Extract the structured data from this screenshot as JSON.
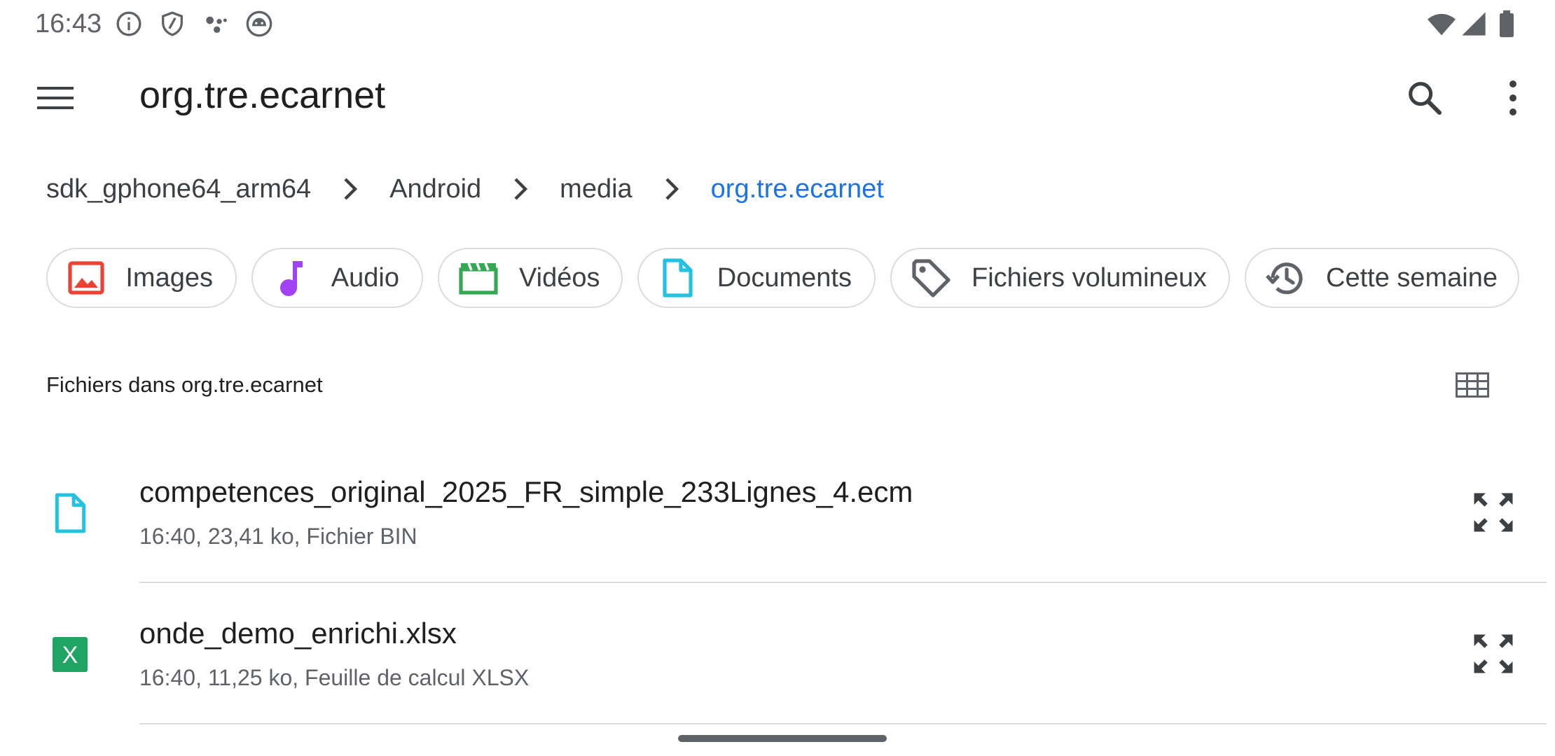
{
  "status_bar": {
    "time": "16:43",
    "icons": [
      "info-icon",
      "shield-icon",
      "assistant-dots-icon",
      "android-face-icon",
      "wifi-icon",
      "signal-icon",
      "battery-icon"
    ]
  },
  "app_bar": {
    "title": "org.tre.ecarnet",
    "menu_icon": "hamburger-menu-icon",
    "search_icon": "search-icon",
    "more_icon": "more-vert-icon"
  },
  "breadcrumb": {
    "items": [
      "sdk_gphone64_arm64",
      "Android",
      "media",
      "org.tre.ecarnet"
    ],
    "separator_icon": "chevron-right-icon"
  },
  "chips": [
    {
      "label": "Images",
      "icon": "image-icon",
      "color": "#ea4335"
    },
    {
      "label": "Audio",
      "icon": "music-note-icon",
      "color": "#a142f4"
    },
    {
      "label": "Vidéos",
      "icon": "movie-clapper-icon",
      "color": "#34a853"
    },
    {
      "label": "Documents",
      "icon": "document-icon",
      "color": "#24c1e0"
    },
    {
      "label": "Fichiers volumineux",
      "icon": "tag-icon",
      "color": "#5f6368"
    },
    {
      "label": "Cette semaine",
      "icon": "history-icon",
      "color": "#5f6368"
    }
  ],
  "section": {
    "title": "Fichiers dans org.tre.ecarnet",
    "view_toggle_icon": "grid-view-icon"
  },
  "files": [
    {
      "name": "competences_original_2025_FR_simple_233Lignes_4.ecm",
      "meta": "16:40, 23,41 ko, Fichier BIN",
      "icon": "document-icon",
      "color": "#24c1e0"
    },
    {
      "name": "onde_demo_enrichi.xlsx",
      "meta": "16:40, 11,25 ko, Feuille de calcul XLSX",
      "icon": "spreadsheet-icon",
      "color": "#1fa463",
      "icon_letter": "X"
    }
  ],
  "colors": {
    "accent": "#1a73e8",
    "text_primary": "#1f1f1f",
    "text_secondary": "#5f6368",
    "divider": "#dadce0"
  }
}
